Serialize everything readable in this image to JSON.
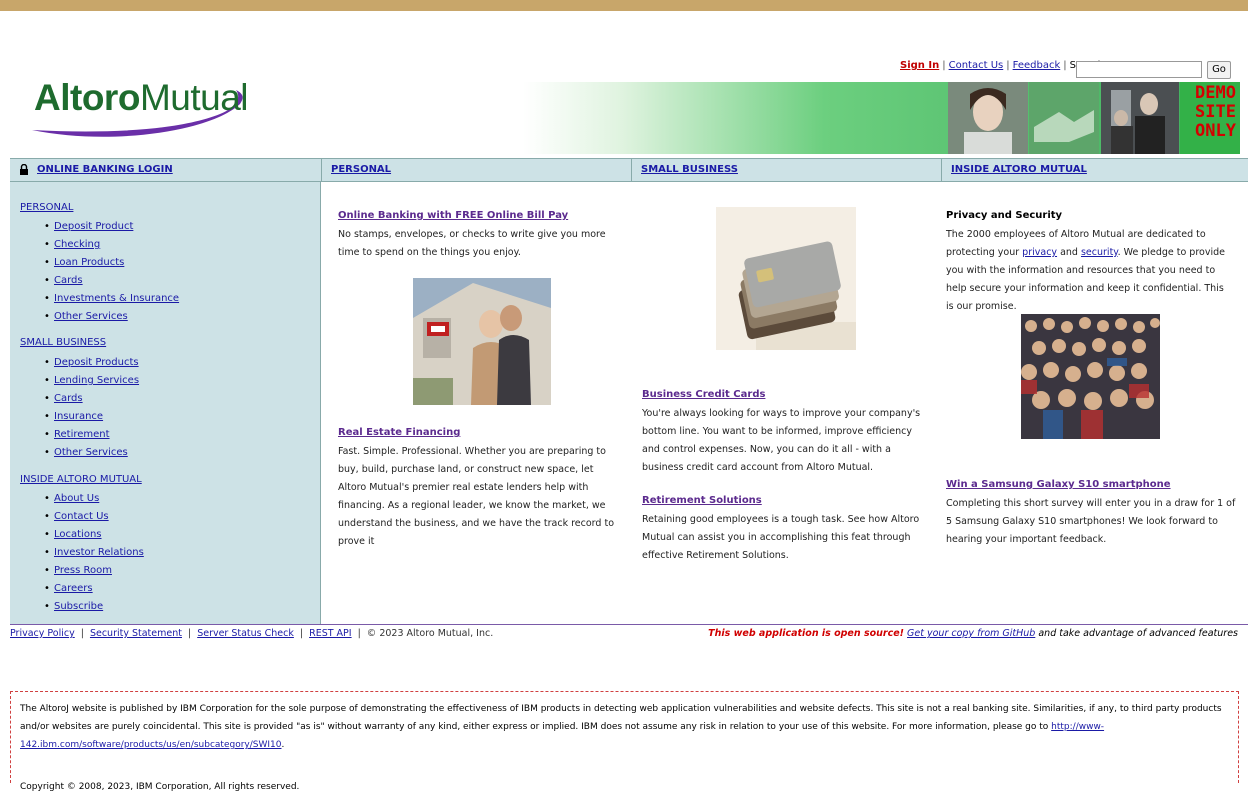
{
  "brand": {
    "name_bold": "Altoro",
    "name_rest": "Mutual"
  },
  "util": {
    "sign_in": "Sign In",
    "contact": "Contact Us",
    "feedback": "Feedback",
    "search_label": "Search",
    "search_value": "",
    "go_label": "Go"
  },
  "banner": {
    "demo_lines": [
      "DEMO",
      "SITE",
      "ONLY"
    ]
  },
  "nav": {
    "login": "ONLINE BANKING LOGIN",
    "personal": "PERSONAL",
    "small_business": "SMALL BUSINESS",
    "inside": "INSIDE ALTORO MUTUAL"
  },
  "sidebar": {
    "personal": {
      "title": "PERSONAL",
      "items": [
        "Deposit Product",
        "Checking",
        "Loan Products",
        "Cards",
        "Investments & Insurance",
        "Other Services"
      ]
    },
    "small_business": {
      "title": "SMALL BUSINESS",
      "items": [
        "Deposit Products",
        "Lending Services",
        "Cards",
        "Insurance",
        "Retirement",
        "Other Services"
      ]
    },
    "inside": {
      "title": "INSIDE ALTORO MUTUAL",
      "items": [
        "About Us",
        "Contact Us",
        "Locations",
        "Investor Relations",
        "Press Room",
        "Careers",
        "Subscribe"
      ]
    }
  },
  "col1": {
    "a_title": "Online Banking with FREE Online Bill Pay",
    "a_text": "No stamps, envelopes, or checks to write give you more time to spend on the things you enjoy.",
    "b_title": "Real Estate Financing",
    "b_text": "Fast. Simple. Professional. Whether you are preparing to buy, build, purchase land, or construct new space, let Altoro Mutual's premier real estate lenders help with financing. As a regional leader, we know the market, we understand the business, and we have the track record to prove it"
  },
  "col2": {
    "a_title": "Business Credit Cards",
    "a_text": "You're always looking for ways to improve your company's bottom line. You want to be informed, improve efficiency and control expenses. Now, you can do it all - with a business credit card account from Altoro Mutual.",
    "b_title": "Retirement Solutions",
    "b_text": "Retaining good employees is a tough task. See how Altoro Mutual can assist you in accomplishing this feat through effective Retirement Solutions."
  },
  "col3": {
    "a_title": "Privacy and Security",
    "a_text_1": "The 2000 employees of Altoro Mutual are dedicated to protecting your",
    "a_link_privacy": "privacy",
    "a_and": "and",
    "a_link_security": "security",
    "a_text_2": ". We pledge to provide you with the information and resources that you need to help secure your information and keep it confidential. This is our promise.",
    "b_title": "Win a Samsung Galaxy S10 smartphone",
    "b_text": "Completing this short survey will enter you in a draw for 1 of 5 Samsung Galaxy S10 smartphones! We look forward to hearing your important feedback."
  },
  "footer": {
    "privacy": "Privacy Policy",
    "security": "Security Statement",
    "status": "Server Status Check",
    "rest": "REST API",
    "copyright": "© 2023 Altoro Mutual, Inc.",
    "oss_red": "This web application is open source!",
    "oss_link": "Get your copy from GitHub",
    "oss_rest": "and take advantage of advanced features"
  },
  "disclaimer": {
    "text": "The AltoroJ website is published by IBM Corporation for the sole purpose of demonstrating the effectiveness of IBM products in detecting web application vulnerabilities and website defects. This site is not a real banking site. Similarities, if any, to third party products and/or websites are purely coincidental. This site is provided \"as is\" without warranty of any kind, either express or implied. IBM does not assume any risk in relation to your use of this website. For more information, please go to",
    "link": "http://www-142.ibm.com/software/products/us/en/subcategory/SWI10",
    "copyright": "Copyright © 2008, 2023, IBM Corporation, All rights reserved."
  }
}
